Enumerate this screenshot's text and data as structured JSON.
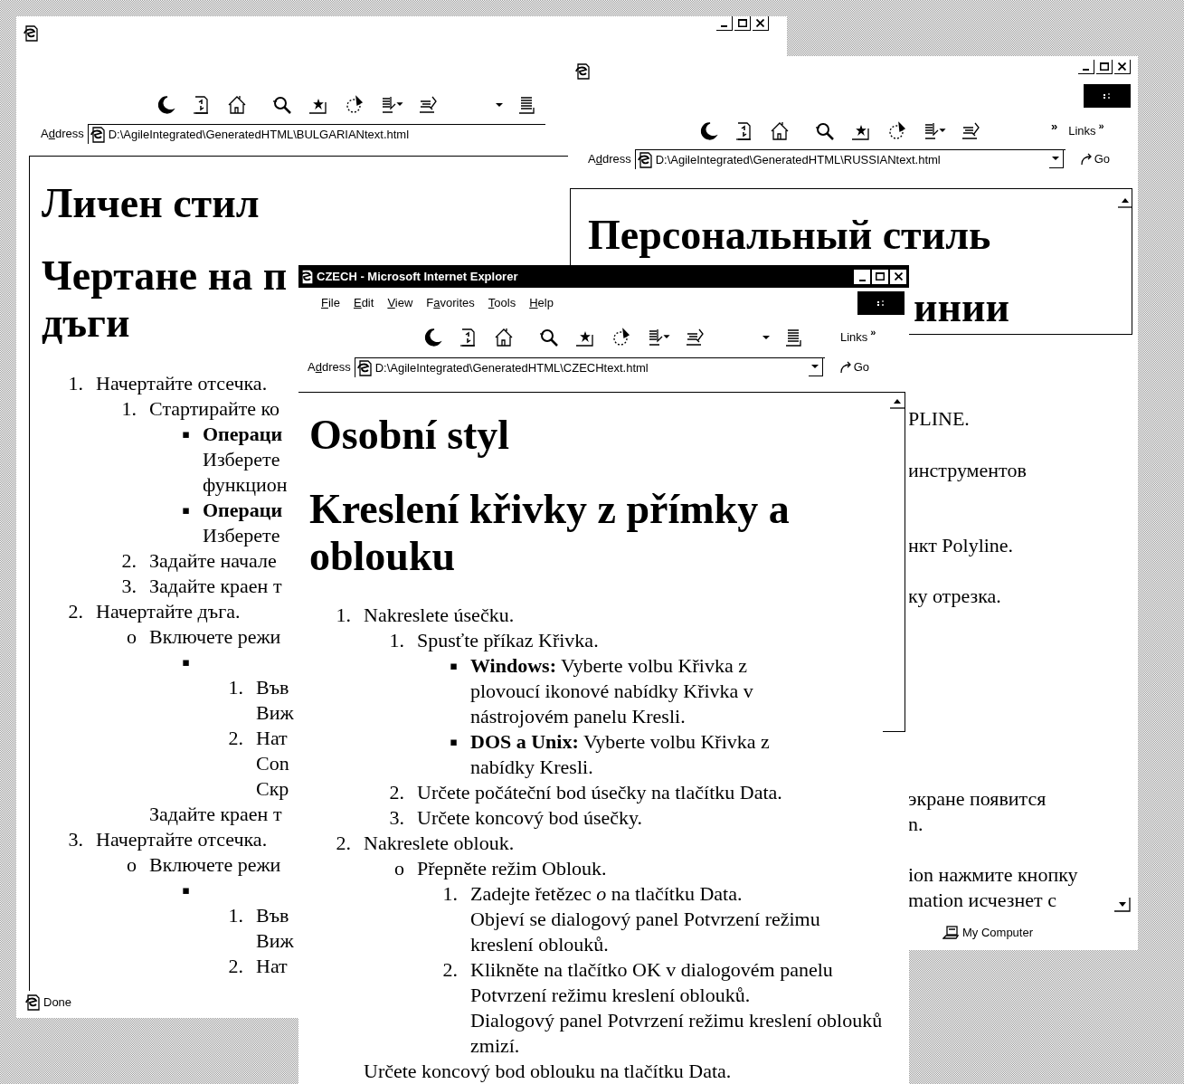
{
  "bulgarian_window": {
    "active": false,
    "address": {
      "label": {
        "lead": "A",
        "accel": "d",
        "rest": "dress"
      },
      "url": "D:\\AgileIntegrated\\GeneratedHTML\\BULGARIANtext.html"
    },
    "headings": [
      {
        "lines": [
          "Личен стил"
        ]
      },
      {
        "lines": [
          "Чертане на п",
          "дъги"
        ]
      }
    ],
    "list": [
      {
        "marker": "1.",
        "lines": [
          "Начертайте отсечка."
        ],
        "children": [
          {
            "marker": "1.",
            "lines": [
              "Стартирайте ко"
            ],
            "children": [
              {
                "marker": "▪",
                "lines": [
                  "**Операци**",
                  "Изберете",
                  "функцион"
                ]
              },
              {
                "marker": "▪",
                "lines": [
                  "**Операци**",
                  "Изберете"
                ]
              }
            ]
          },
          {
            "marker": "2.",
            "lines": [
              "Задайте начале"
            ]
          },
          {
            "marker": "3.",
            "lines": [
              "Задайте краен т"
            ]
          }
        ]
      },
      {
        "marker": "2.",
        "lines": [
          "Начертайте дъга."
        ],
        "children": [
          {
            "marker": "o",
            "lines": [
              "Включете режи"
            ],
            "children": [
              {
                "marker": "▪",
                "children": [
                  {
                    "marker": "1.",
                    "lines": [
                      "Във",
                      "Виж"
                    ]
                  },
                  {
                    "marker": "2.",
                    "lines": [
                      "Нат",
                      "Con",
                      "Скр"
                    ]
                  }
                ]
              }
            ],
            "tail": [
              "Задайте краен т"
            ]
          }
        ]
      },
      {
        "marker": "3.",
        "lines": [
          "Начертайте отсечка."
        ],
        "children": [
          {
            "marker": "o",
            "lines": [
              "Включете режи"
            ],
            "children": [
              {
                "marker": "▪",
                "children": [
                  {
                    "marker": "1.",
                    "lines": [
                      "Във",
                      "Виж"
                    ]
                  },
                  {
                    "marker": "2.",
                    "lines": [
                      "Нат"
                    ]
                  }
                ]
              }
            ]
          }
        ]
      }
    ],
    "status": "Done"
  },
  "russian_window": {
    "active": false,
    "toolbar_overflow": "»",
    "links_label": "Links",
    "links_chevron": "»",
    "address": {
      "label": {
        "lead": "A",
        "accel": "d",
        "rest": "dress"
      },
      "url": "D:\\AgileIntegrated\\GeneratedHTML\\RUSSIANtext.html"
    },
    "go_label": "Go",
    "heading": "Персональный стиль",
    "fragments": [
      {
        "kind": "heading",
        "lines": [
          "инии"
        ]
      },
      {
        "kind": "text",
        "lines": [
          "PLINE."
        ]
      },
      {
        "kind": "text",
        "lines": [
          "инструментов"
        ]
      },
      {
        "kind": "text",
        "lines": [
          "нкт Polyline."
        ]
      },
      {
        "kind": "text",
        "lines": [
          "ку отрезка."
        ]
      },
      {
        "kind": "text",
        "lines": [
          "экране появится",
          "n."
        ]
      },
      {
        "kind": "text",
        "lines": [
          "ion нажмите кнопку",
          "mation исчезнет с"
        ]
      }
    ],
    "status": "My Computer"
  },
  "czech_window": {
    "active": true,
    "title": "CZECH - Microsoft Internet Explorer",
    "menu": [
      {
        "accel": "F",
        "rest": "ile"
      },
      {
        "accel": "E",
        "rest": "dit"
      },
      {
        "accel": "V",
        "rest": "iew"
      },
      {
        "lead": "F",
        "accel": "a",
        "rest": "vorites"
      },
      {
        "accel": "T",
        "rest": "ools"
      },
      {
        "accel": "H",
        "rest": "elp"
      }
    ],
    "links_label": "Links",
    "links_chevron": "»",
    "address": {
      "label": {
        "lead": "A",
        "accel": "d",
        "rest": "dress"
      },
      "url": "D:\\AgileIntegrated\\GeneratedHTML\\CZECHtext.html"
    },
    "go_label": "Go",
    "headings": [
      {
        "lines": [
          "Osobní styl"
        ]
      },
      {
        "lines": [
          "Kreslení křivky z přímky a",
          "oblouku"
        ]
      }
    ],
    "list": [
      {
        "marker": "1.",
        "lines": [
          "Nakreslete úsečku."
        ],
        "children": [
          {
            "marker": "1.",
            "lines": [
              "Spusťte příkaz Křivka."
            ],
            "children": [
              {
                "marker": "▪",
                "lines": [
                  "**Windows:** Vyberte volbu Křivka z",
                  "plovoucí ikonové nabídky Křivka v",
                  "nástrojovém panelu Kresli."
                ]
              },
              {
                "marker": "▪",
                "lines": [
                  "**DOS a Unix:** Vyberte volbu Křivka z",
                  "nabídky Kresli."
                ]
              }
            ]
          },
          {
            "marker": "2.",
            "lines": [
              "Určete počáteční bod úsečky na tlačítku Data."
            ]
          },
          {
            "marker": "3.",
            "lines": [
              "Určete koncový bod úsečky."
            ]
          }
        ]
      },
      {
        "marker": "2.",
        "lines": [
          "Nakreslete oblouk."
        ],
        "children": [
          {
            "marker": "o",
            "lines": [
              "Přepněte režim Oblouk."
            ],
            "children": [
              {
                "marker": "1.",
                "lines": [
                  "Zadejte řetězec *o* na tlačítku Data."
                ],
                "note": [
                  "Objeví se dialogový panel Potvrzení režimu",
                  "kreslení oblouků."
                ]
              },
              {
                "marker": "2.",
                "lines": [
                  "Klikněte na tlačítko OK v dialogovém panelu",
                  "Potvrzení režimu kreslení oblouků."
                ],
                "note": [
                  "Dialogový panel Potvrzení režimu kreslení oblouků",
                  "zmizí."
                ]
              }
            ]
          }
        ],
        "tail": [
          "Určete koncový bod oblouku na tlačítku Data."
        ]
      }
    ]
  }
}
